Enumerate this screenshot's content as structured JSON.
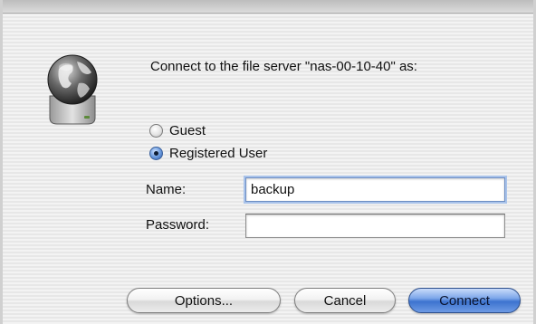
{
  "dialog": {
    "prompt": "Connect to the file server \"nas-00-10-40\" as:",
    "icon": "network-server-globe-icon"
  },
  "login_options": {
    "guest_label": "Guest",
    "registered_label": "Registered User",
    "selected": "Registered User"
  },
  "fields": {
    "name_label": "Name:",
    "name_value": "backup",
    "password_label": "Password:",
    "password_value": ""
  },
  "buttons": {
    "options_label": "Options...",
    "cancel_label": "Cancel",
    "connect_label": "Connect",
    "default_button_color": "#3d73cf"
  }
}
